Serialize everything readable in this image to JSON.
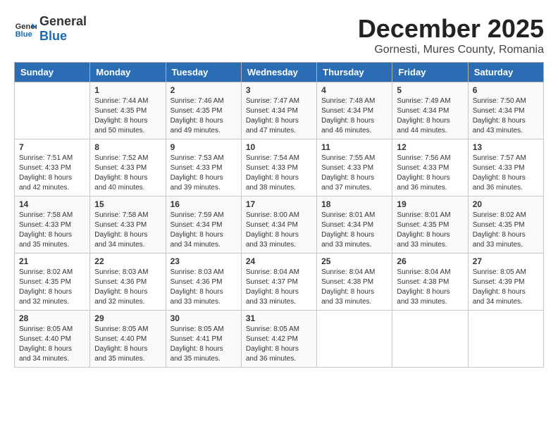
{
  "logo": {
    "general": "General",
    "blue": "Blue"
  },
  "title": "December 2025",
  "location": "Gornesti, Mures County, Romania",
  "days_header": [
    "Sunday",
    "Monday",
    "Tuesday",
    "Wednesday",
    "Thursday",
    "Friday",
    "Saturday"
  ],
  "weeks": [
    [
      {
        "day": "",
        "content": ""
      },
      {
        "day": "1",
        "content": "Sunrise: 7:44 AM\nSunset: 4:35 PM\nDaylight: 8 hours\nand 50 minutes."
      },
      {
        "day": "2",
        "content": "Sunrise: 7:46 AM\nSunset: 4:35 PM\nDaylight: 8 hours\nand 49 minutes."
      },
      {
        "day": "3",
        "content": "Sunrise: 7:47 AM\nSunset: 4:34 PM\nDaylight: 8 hours\nand 47 minutes."
      },
      {
        "day": "4",
        "content": "Sunrise: 7:48 AM\nSunset: 4:34 PM\nDaylight: 8 hours\nand 46 minutes."
      },
      {
        "day": "5",
        "content": "Sunrise: 7:49 AM\nSunset: 4:34 PM\nDaylight: 8 hours\nand 44 minutes."
      },
      {
        "day": "6",
        "content": "Sunrise: 7:50 AM\nSunset: 4:34 PM\nDaylight: 8 hours\nand 43 minutes."
      }
    ],
    [
      {
        "day": "7",
        "content": "Sunrise: 7:51 AM\nSunset: 4:33 PM\nDaylight: 8 hours\nand 42 minutes."
      },
      {
        "day": "8",
        "content": "Sunrise: 7:52 AM\nSunset: 4:33 PM\nDaylight: 8 hours\nand 40 minutes."
      },
      {
        "day": "9",
        "content": "Sunrise: 7:53 AM\nSunset: 4:33 PM\nDaylight: 8 hours\nand 39 minutes."
      },
      {
        "day": "10",
        "content": "Sunrise: 7:54 AM\nSunset: 4:33 PM\nDaylight: 8 hours\nand 38 minutes."
      },
      {
        "day": "11",
        "content": "Sunrise: 7:55 AM\nSunset: 4:33 PM\nDaylight: 8 hours\nand 37 minutes."
      },
      {
        "day": "12",
        "content": "Sunrise: 7:56 AM\nSunset: 4:33 PM\nDaylight: 8 hours\nand 36 minutes."
      },
      {
        "day": "13",
        "content": "Sunrise: 7:57 AM\nSunset: 4:33 PM\nDaylight: 8 hours\nand 36 minutes."
      }
    ],
    [
      {
        "day": "14",
        "content": "Sunrise: 7:58 AM\nSunset: 4:33 PM\nDaylight: 8 hours\nand 35 minutes."
      },
      {
        "day": "15",
        "content": "Sunrise: 7:58 AM\nSunset: 4:33 PM\nDaylight: 8 hours\nand 34 minutes."
      },
      {
        "day": "16",
        "content": "Sunrise: 7:59 AM\nSunset: 4:34 PM\nDaylight: 8 hours\nand 34 minutes."
      },
      {
        "day": "17",
        "content": "Sunrise: 8:00 AM\nSunset: 4:34 PM\nDaylight: 8 hours\nand 33 minutes."
      },
      {
        "day": "18",
        "content": "Sunrise: 8:01 AM\nSunset: 4:34 PM\nDaylight: 8 hours\nand 33 minutes."
      },
      {
        "day": "19",
        "content": "Sunrise: 8:01 AM\nSunset: 4:35 PM\nDaylight: 8 hours\nand 33 minutes."
      },
      {
        "day": "20",
        "content": "Sunrise: 8:02 AM\nSunset: 4:35 PM\nDaylight: 8 hours\nand 33 minutes."
      }
    ],
    [
      {
        "day": "21",
        "content": "Sunrise: 8:02 AM\nSunset: 4:35 PM\nDaylight: 8 hours\nand 32 minutes."
      },
      {
        "day": "22",
        "content": "Sunrise: 8:03 AM\nSunset: 4:36 PM\nDaylight: 8 hours\nand 32 minutes."
      },
      {
        "day": "23",
        "content": "Sunrise: 8:03 AM\nSunset: 4:36 PM\nDaylight: 8 hours\nand 33 minutes."
      },
      {
        "day": "24",
        "content": "Sunrise: 8:04 AM\nSunset: 4:37 PM\nDaylight: 8 hours\nand 33 minutes."
      },
      {
        "day": "25",
        "content": "Sunrise: 8:04 AM\nSunset: 4:38 PM\nDaylight: 8 hours\nand 33 minutes."
      },
      {
        "day": "26",
        "content": "Sunrise: 8:04 AM\nSunset: 4:38 PM\nDaylight: 8 hours\nand 33 minutes."
      },
      {
        "day": "27",
        "content": "Sunrise: 8:05 AM\nSunset: 4:39 PM\nDaylight: 8 hours\nand 34 minutes."
      }
    ],
    [
      {
        "day": "28",
        "content": "Sunrise: 8:05 AM\nSunset: 4:40 PM\nDaylight: 8 hours\nand 34 minutes."
      },
      {
        "day": "29",
        "content": "Sunrise: 8:05 AM\nSunset: 4:40 PM\nDaylight: 8 hours\nand 35 minutes."
      },
      {
        "day": "30",
        "content": "Sunrise: 8:05 AM\nSunset: 4:41 PM\nDaylight: 8 hours\nand 35 minutes."
      },
      {
        "day": "31",
        "content": "Sunrise: 8:05 AM\nSunset: 4:42 PM\nDaylight: 8 hours\nand 36 minutes."
      },
      {
        "day": "",
        "content": ""
      },
      {
        "day": "",
        "content": ""
      },
      {
        "day": "",
        "content": ""
      }
    ]
  ]
}
